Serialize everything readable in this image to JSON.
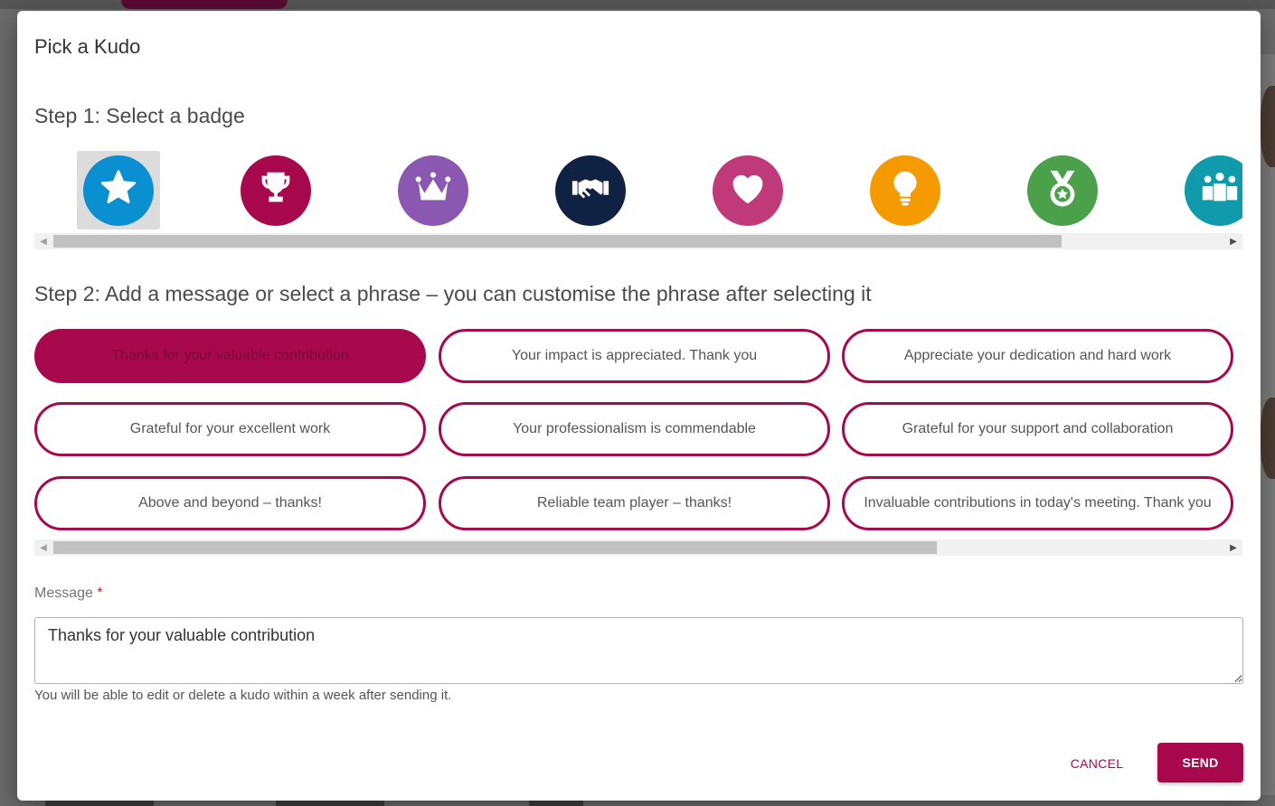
{
  "dialog": {
    "title": "Pick a Kudo",
    "step1_heading": "Step 1: Select a badge",
    "step2_heading": "Step 2: Add a message or select a phrase – you can customise the phrase after selecting it"
  },
  "badges": [
    {
      "icon": "star-icon",
      "color": "#0a8fd0",
      "selected": true
    },
    {
      "icon": "trophy-icon",
      "color": "#a8094c",
      "selected": false
    },
    {
      "icon": "crown-icon",
      "color": "#8a58b0",
      "selected": false
    },
    {
      "icon": "handshake-icon",
      "color": "#0f2244",
      "selected": false
    },
    {
      "icon": "heart-icon",
      "color": "#c03a7a",
      "selected": false
    },
    {
      "icon": "lightbulb-icon",
      "color": "#f59a00",
      "selected": false
    },
    {
      "icon": "medal-icon",
      "color": "#4aa14a",
      "selected": false
    },
    {
      "icon": "team-icon",
      "color": "#0f9bab",
      "selected": false
    }
  ],
  "phrases": [
    {
      "label": "Thanks for your valuable contribution",
      "selected": true
    },
    {
      "label": "Your impact is appreciated. Thank you",
      "selected": false
    },
    {
      "label": "Appreciate your dedication and hard work",
      "selected": false
    },
    {
      "label": "Grateful for your excellent work",
      "selected": false
    },
    {
      "label": "Your professionalism is commendable",
      "selected": false
    },
    {
      "label": "Grateful for your support and collaboration",
      "selected": false
    },
    {
      "label": "Above and beyond – thanks!",
      "selected": false
    },
    {
      "label": "Reliable team player – thanks!",
      "selected": false
    },
    {
      "label": "Invaluable contributions in today's meeting. Thank you",
      "selected": false
    }
  ],
  "message": {
    "label": "Message",
    "required_mark": "*",
    "value": "Thanks for your valuable contribution",
    "hint": "You will be able to edit or delete a kudo within a week after sending it."
  },
  "actions": {
    "cancel_label": "CANCEL",
    "send_label": "SEND"
  },
  "scroll": {
    "badges_scroll_position": 0,
    "phrases_scroll_position": 0
  },
  "colors": {
    "accent": "#a8094c",
    "selected_badge_bg": "#dcdcdc"
  }
}
